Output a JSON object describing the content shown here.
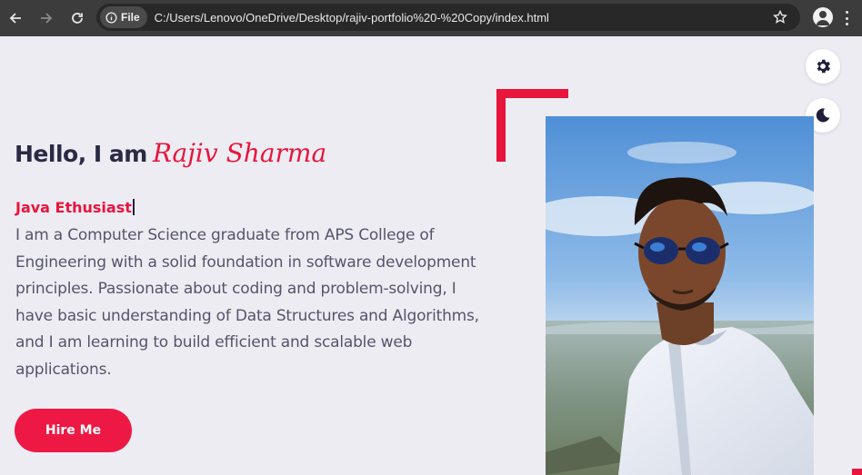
{
  "browser": {
    "url": "C:/Users/Lenovo/OneDrive/Desktop/rajiv-portfolio%20-%20Copy/index.html",
    "site_info_label": "File",
    "icons": [
      "back-arrow-icon",
      "forward-arrow-icon",
      "reload-icon",
      "info-icon",
      "star-icon",
      "profile-icon",
      "kebab-menu-icon"
    ]
  },
  "toolbar": {
    "settings_icon": "gear-icon",
    "theme_icon": "moon-icon"
  },
  "hero": {
    "greeting": "Hello, I am",
    "name": "Rajiv Sharma",
    "role": "Java Ethusiast",
    "description": "I am a Computer Science graduate from APS College of Engineering with a solid foundation in software development principles. Passionate about coding and problem-solving, I have basic understanding of Data Structures and Algorithms, and I am learning to build efficient and scalable web applications.",
    "cta_label": "Hire Me"
  },
  "colors": {
    "accent": "#e8153c",
    "button": "#ee1844",
    "heading": "#2a2a44",
    "body_text": "#55556a",
    "background": "#eeecf3",
    "chrome": "#3c3c3c"
  }
}
